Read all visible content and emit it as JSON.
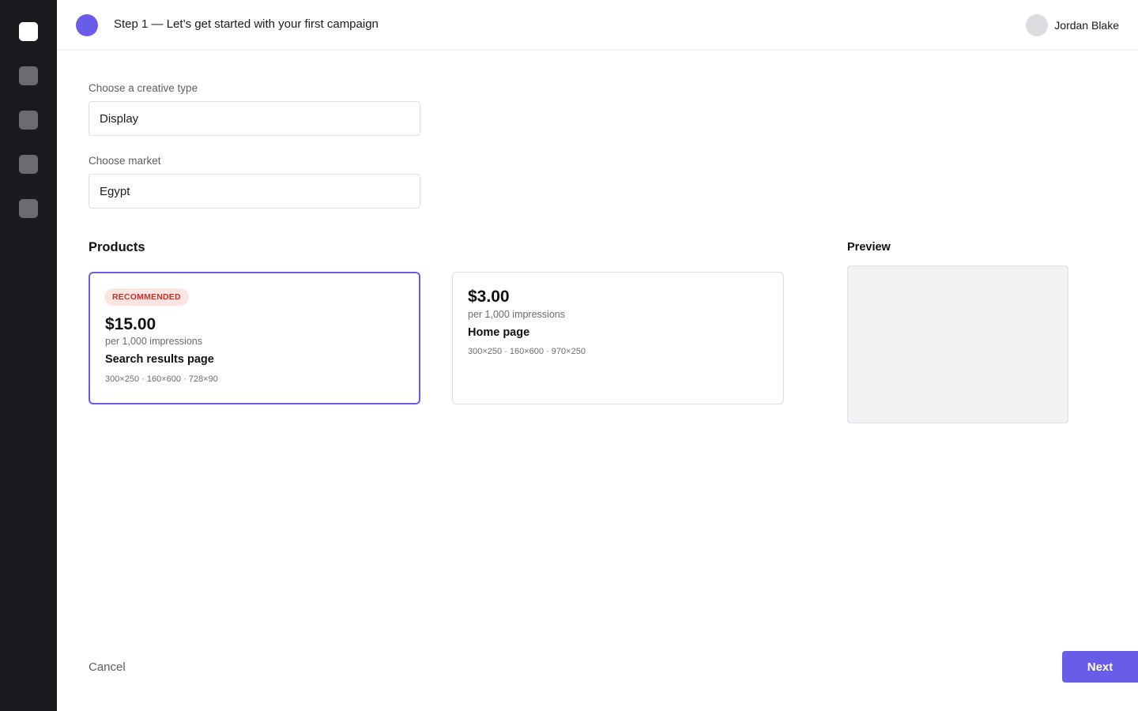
{
  "colors": {
    "accent": "#6a5ce8",
    "sidebar_bg": "#1b1b1f",
    "badge_bg": "#fbe5e3",
    "badge_text": "#c0362c"
  },
  "sidebar": {
    "logo_icon": "app-logo-icon",
    "items": [
      {
        "icon": "nav-icon-1"
      },
      {
        "icon": "nav-icon-2"
      },
      {
        "icon": "nav-icon-3"
      },
      {
        "icon": "nav-icon-4"
      }
    ]
  },
  "header": {
    "title": "Step 1 — Let’s get started with your first campaign",
    "user_name": "Jordan Blake"
  },
  "form": {
    "creative_type": {
      "label": "Choose a creative type",
      "value": "Display"
    },
    "market": {
      "label": "Choose market",
      "value": "Egypt"
    }
  },
  "products": {
    "title": "Products",
    "items": [
      {
        "badge": "RECOMMENDED",
        "price": "$15.00",
        "per": "per 1,000 impressions",
        "name": "Search results page",
        "sizes": "300×250 · 160×600 · 728×90",
        "selected": true
      },
      {
        "badge": "",
        "price": "$3.00",
        "per": "per 1,000 impressions",
        "name": "Home page",
        "sizes": "300×250 · 160×600 · 970×250",
        "selected": false
      }
    ]
  },
  "preview": {
    "title": "Preview"
  },
  "footer": {
    "cancel_label": "Cancel",
    "next_label": "Next"
  }
}
